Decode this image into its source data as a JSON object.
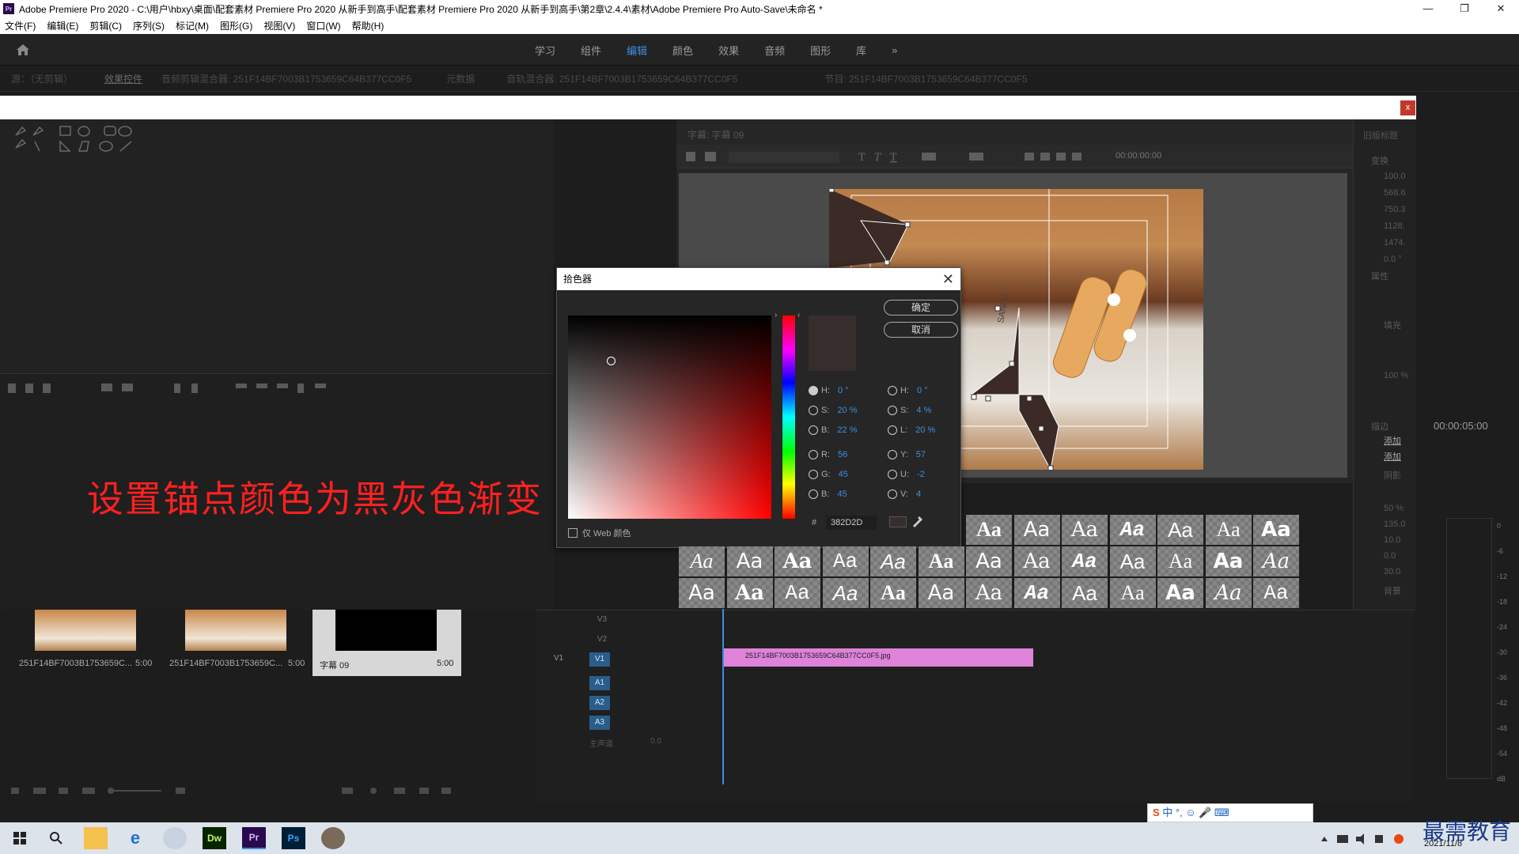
{
  "window": {
    "title": "Adobe Premiere Pro 2020 - C:\\用户\\hbxy\\桌面\\配套素材 Premiere Pro 2020 从新手到高手\\配套素材 Premiere Pro 2020 从新手到高手\\第2章\\2.4.4\\素材\\Adobe Premiere Pro Auto-Save\\未命名 *",
    "app_badge": "Pr",
    "controls": [
      "—",
      "❐",
      "✕"
    ]
  },
  "menubar": [
    "文件(F)",
    "编辑(E)",
    "剪辑(C)",
    "序列(S)",
    "标记(M)",
    "图形(G)",
    "视图(V)",
    "窗口(W)",
    "帮助(H)"
  ],
  "workspace_tabs": [
    "学习",
    "组件",
    "编辑",
    "颜色",
    "效果",
    "音频",
    "图形",
    "库"
  ],
  "workspace_active": "编辑",
  "workspace_more": "»",
  "panel_tabs": [
    "源：（无剪辑）",
    "效果控件",
    "音频剪辑混合器: 251F14BF7003B1753659C64B377CC0F5",
    "元数据",
    "音轨混合器: 251F14BF7003B1753659C64B377CC0F5",
    "节目: 251F14BF7003B1753659C64B377CC0F5"
  ],
  "white_close": "x",
  "title_viewer": {
    "header": "字幕: 字幕 09",
    "timecode": "00:00:00:00",
    "logo_text": "SANFU"
  },
  "caption_overlay": "设置锚点颜色为黑灰色渐变",
  "props": {
    "header": "旧版标题",
    "labels": [
      "变换",
      "属性",
      "填充",
      "描边",
      "阴影",
      "背景"
    ],
    "values": [
      "100.0",
      "568.6",
      "750.3",
      "1128.",
      "1474.",
      "0.0 °",
      "100 %",
      "50 %",
      "135.0",
      "10.0",
      "0.0",
      "30.0"
    ],
    "add1": "添加",
    "add2": "添加",
    "duration": "00:00:05:00"
  },
  "picker": {
    "title": "拾色器",
    "ok": "确定",
    "cancel": "取消",
    "hex_label": "#",
    "hex": "382D2D",
    "web_only": "仅 Web 颜色",
    "color": "#382D2D",
    "hsb_left": [
      {
        "label": "H:",
        "value": "0 °"
      },
      {
        "label": "S:",
        "value": "20 %"
      },
      {
        "label": "B:",
        "value": "22 %"
      }
    ],
    "rgb": [
      {
        "label": "R:",
        "value": "56"
      },
      {
        "label": "G:",
        "value": "45"
      },
      {
        "label": "B:",
        "value": "45"
      }
    ],
    "hsl_right": [
      {
        "label": "H:",
        "value": "0 °"
      },
      {
        "label": "S:",
        "value": "4 %"
      },
      {
        "label": "L:",
        "value": "20 %"
      }
    ],
    "yuv": [
      {
        "label": "Y:",
        "value": "57"
      },
      {
        "label": "U:",
        "value": "-2"
      },
      {
        "label": "V:",
        "value": "4"
      }
    ]
  },
  "style_sample": "Aa",
  "timeline": {
    "video_tracks": [
      "V3",
      "V2",
      "V1"
    ],
    "audio_tracks": [
      "A1",
      "A2",
      "A3"
    ],
    "v1_source": "V1",
    "master": "主声道",
    "master_val": "0.0",
    "clip_name": "251F14BF7003B1753659C64B377CC0F5.jpg"
  },
  "meter_scale": [
    "0",
    "-6",
    "-12",
    "-18",
    "-24",
    "-30",
    "-36",
    "-42",
    "-48",
    "-54",
    "dB"
  ],
  "bin": [
    {
      "name": "251F14BF7003B1753659C...",
      "dur": "5:00"
    },
    {
      "name": "251F14BF7003B1753659C...",
      "dur": "5:00"
    },
    {
      "name": "字幕 09",
      "dur": "5:00"
    }
  ],
  "ime": "中 °, ☺ 🎤 ⌨",
  "watermark": "最需教育",
  "clock": "2021/11/8"
}
